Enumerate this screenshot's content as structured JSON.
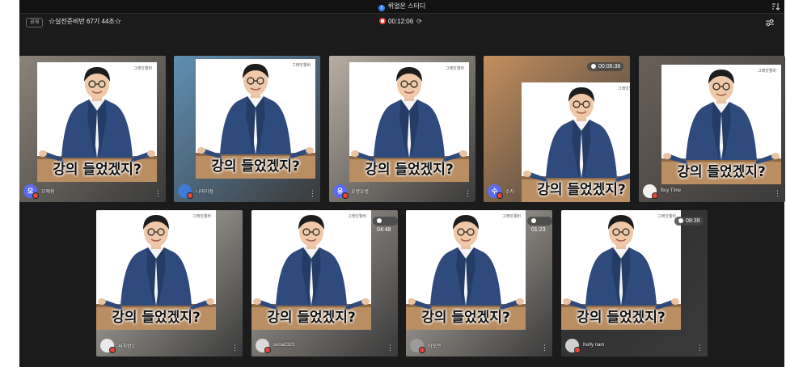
{
  "window": {
    "title": "뤼얼온 스터디"
  },
  "topbar": {
    "badge": "공개",
    "room_name": "☆실전준비반 67기 44조☆",
    "timer": "00:12:06"
  },
  "meme": {
    "caption": "강의 들었겠지?",
    "watermark": "그레잇웰비"
  },
  "icons": {
    "info": "info-icon",
    "sort": "sort-icon",
    "record": "record-icon",
    "refresh": "refresh-icon",
    "settings": "settings-sliders-icon",
    "more": "more-vertical-icon",
    "mic_off": "mic-off-icon"
  },
  "participants": [
    {
      "name": "모예용",
      "avatar_text": "모",
      "avatar_color": "#5b6cf0",
      "duration": ""
    },
    {
      "name": "나미아정",
      "avatar_text": "",
      "avatar_color": "#3d7bd6",
      "duration": ""
    },
    {
      "name": "유병유병",
      "avatar_text": "유",
      "avatar_color": "#5b6cf0",
      "duration": ""
    },
    {
      "name": "수지",
      "avatar_text": "수",
      "avatar_color": "#5b6cf0",
      "duration": "00:06:38"
    },
    {
      "name": "Buy Time",
      "avatar_text": "",
      "avatar_color": "#f2f2f2",
      "duration": ""
    },
    {
      "name": "씨치현1",
      "avatar_text": "",
      "avatar_color": "#e9e9e9",
      "duration": ""
    },
    {
      "name": "suna0323",
      "avatar_text": "",
      "avatar_color": "#d9d9d9",
      "duration": "04:48"
    },
    {
      "name": "이모르",
      "avatar_text": "",
      "avatar_color": "#9a9a9a",
      "duration": "01:23"
    },
    {
      "name": "Kelly nam",
      "avatar_text": "",
      "avatar_color": "#cfcfcf",
      "duration": "08:39"
    }
  ]
}
